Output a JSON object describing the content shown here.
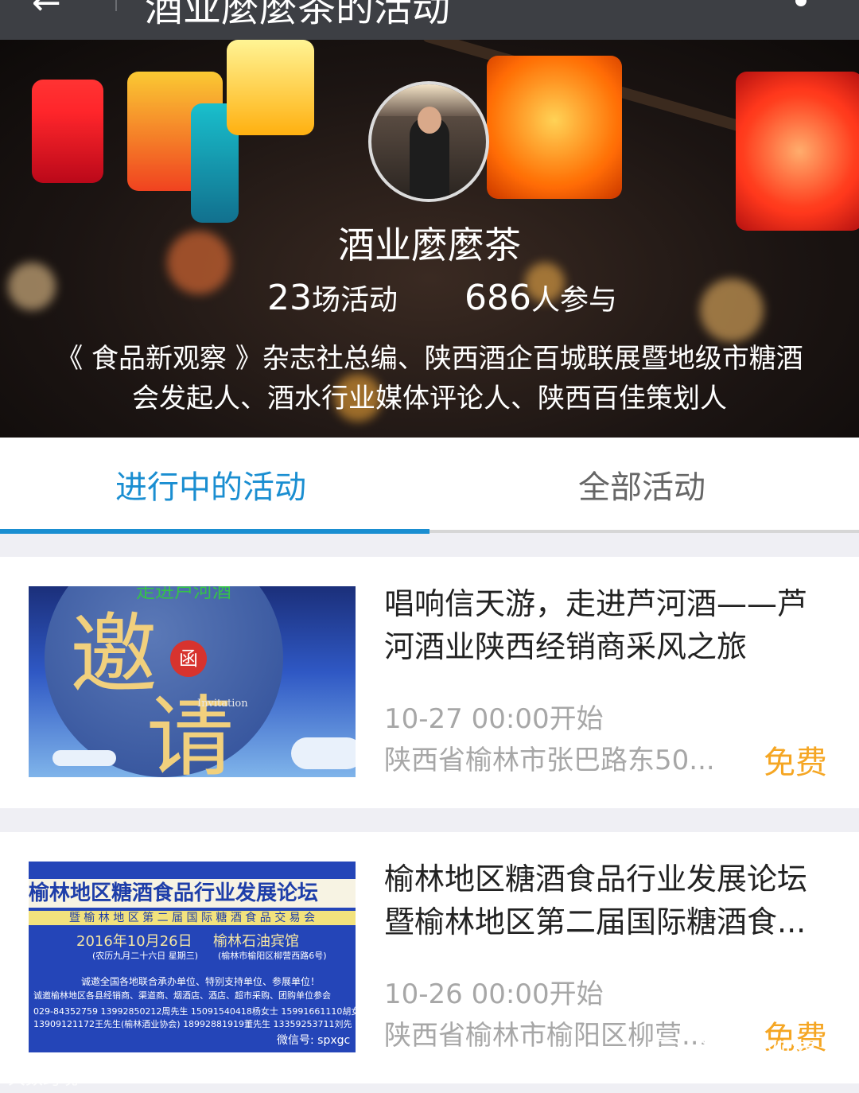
{
  "top_bar": {
    "back_glyph": "←",
    "title": "酒业麼麼茶的活动",
    "more_glyph": "⋮"
  },
  "profile": {
    "name": "酒业麼麼茶",
    "activities_count": "23",
    "activities_unit": "场活动",
    "participants_count": "686",
    "participants_unit": "人参与",
    "bio_line1": "《 食品新观察 》杂志社总编、陕西酒企百城联展暨地级市糖酒",
    "bio_line2": "会发起人、酒水行业媒体评论人、陕西百佳策划人"
  },
  "tabs": [
    {
      "label": "进行中的活动",
      "active": true
    },
    {
      "label": "全部活动",
      "active": false
    }
  ],
  "events": [
    {
      "title_line1": "唱响信天游，走进芦河酒——芦",
      "title_line2": "河酒业陕西经销商采风之旅",
      "time": "10-27 00:00开始",
      "location": "陕西省榆林市张巴路东50...",
      "price": "免费",
      "thumb": {
        "top_text": "走进芦河酒",
        "glyph1": "邀",
        "glyph2": "请",
        "seal": "函",
        "subtitle": "Invitation"
      }
    },
    {
      "title_line1": "榆林地区糖酒食品行业发展论坛",
      "title_line2": "暨榆林地区第二届国际糖酒食...",
      "time": "10-26 00:00开始",
      "location": "陕西省榆林市榆阳区柳营...",
      "price": "免费",
      "thumb": {
        "banner": "榆林地区糖酒食品行业发展论坛",
        "strip": "暨 榆 林 地 区 第 二 届 国 际 糖 酒 食 品 交 易 会",
        "date": "2016年10月26日",
        "venue": "榆林石油宾馆",
        "lunar": "(农历九月二十六日 星期三)",
        "address": "(榆林市榆阳区柳营西路6号)",
        "invite1": "诚邀全国各地联合承办单位、特别支持单位、参展单位！",
        "invite2": "诚邀榆林地区各县经销商、渠道商、烟酒店、酒店、超市采购、团购单位参会",
        "phone1": "029-84352759   13992850212周先生   15091540418杨女士   15991661110胡女",
        "phone2": "13909121172王先生(榆林酒业协会)   18992881919董先生   13359253711刘先",
        "wechat": "微信号: spxgc"
      }
    }
  ],
  "watermarks": {
    "left": "大数跨境",
    "right": "食品新观察"
  },
  "colors": {
    "accent": "#1a8ed1",
    "price": "#f5a623",
    "topbar": "#3d3f44",
    "muted": "#a7a7a7"
  }
}
